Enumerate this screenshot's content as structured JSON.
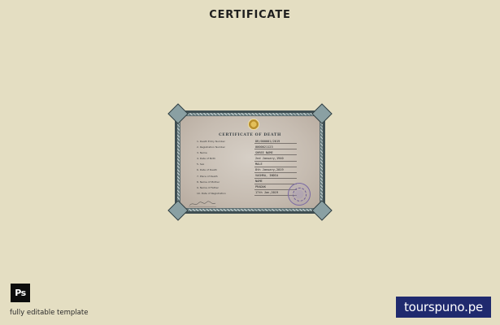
{
  "header": {
    "title": "CERTIFICATE"
  },
  "certificate": {
    "title": "CERTIFICATE OF DEATH",
    "rows": [
      {
        "label": "1. Death Entry Number",
        "value": "DR/000001/2019"
      },
      {
        "label": "2. Registration Number",
        "value": "0000021123"
      },
      {
        "label": "3. Name",
        "value": "SHREE NAME"
      },
      {
        "label": "4. Date of Birth",
        "value": "2nd January,1940"
      },
      {
        "label": "5. Sex",
        "value": "MALE"
      },
      {
        "label": "6. Date of Death",
        "value": "8th January,2019"
      },
      {
        "label": "7. Place of Death",
        "value": "VAGHRA, INDIA"
      },
      {
        "label": "8. Name of Mother",
        "value": "NAME"
      },
      {
        "label": "9. Name of Father",
        "value": "PRADAK"
      },
      {
        "label": "10. Date of Registration",
        "value": "17th Jan,2019"
      }
    ]
  },
  "footer": {
    "ps_badge": "Ps",
    "caption": "fully editable template",
    "brand": "tourspuno.pe"
  },
  "colors": {
    "background": "#e4dec2",
    "frame": "#3f4e52",
    "brand_bg": "#1f2a6e"
  }
}
